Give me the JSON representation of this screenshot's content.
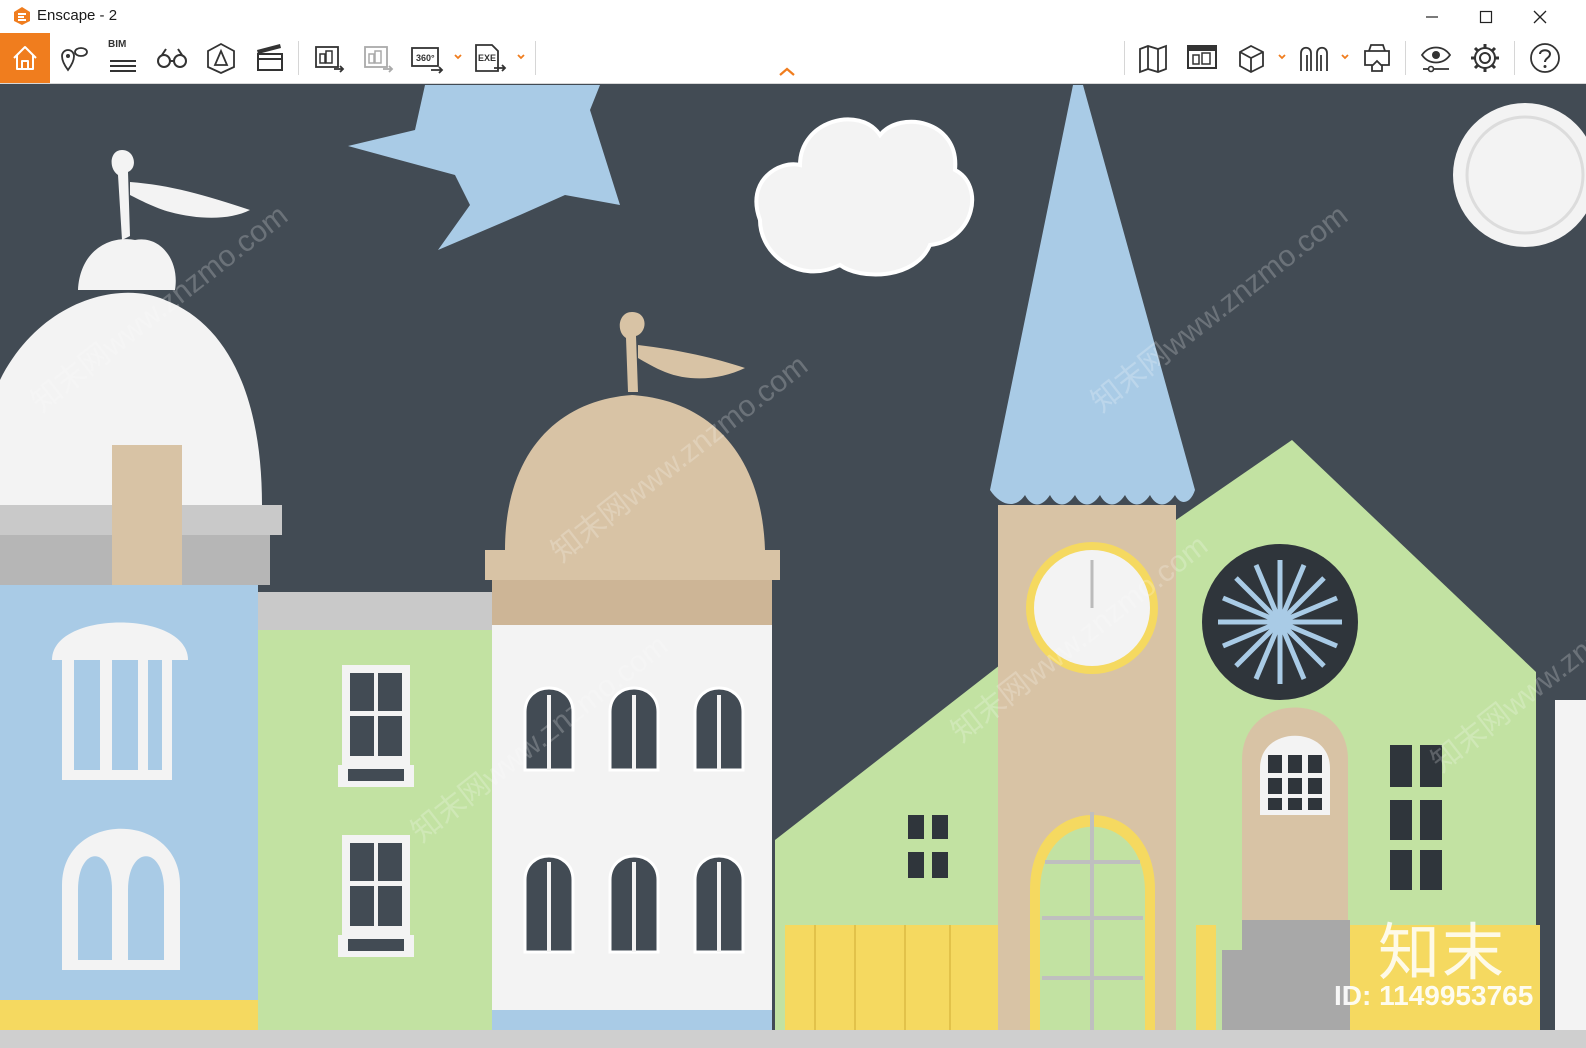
{
  "window": {
    "title": "Enscape - 2",
    "controls": {
      "minimize": "minimize",
      "maximize": "maximize",
      "close": "close"
    }
  },
  "toolbar": {
    "accent_color": "#f07d1e",
    "bim_label": "BIM",
    "pano_label": "360°",
    "exe_label": "EXE",
    "left_tools": [
      {
        "icon": "home-icon"
      },
      {
        "icon": "location-pin-icon"
      },
      {
        "icon": "bim-info-icon"
      },
      {
        "icon": "binoculars-icon"
      },
      {
        "icon": "perspective-icon"
      },
      {
        "icon": "clapperboard-icon"
      },
      {
        "icon": "batch-render-icon"
      },
      {
        "icon": "render-export-icon"
      },
      {
        "icon": "panorama-360-icon"
      },
      {
        "icon": "exe-export-icon"
      }
    ],
    "right_tools": [
      {
        "icon": "map-icon"
      },
      {
        "icon": "asset-library-icon"
      },
      {
        "icon": "section-box-icon"
      },
      {
        "icon": "collaboration-icon"
      },
      {
        "icon": "vr-headset-icon"
      },
      {
        "icon": "visual-settings-icon"
      },
      {
        "icon": "gear-icon"
      },
      {
        "icon": "help-icon"
      }
    ]
  },
  "viewport": {
    "scene": "paper-cut town wall relief",
    "watermarks": [
      "知末网www.znzmo.com"
    ],
    "logo_text": "知末",
    "id_text": "ID: 1149953765",
    "colors": {
      "wall": "#424b54",
      "blue": "#a9cbe6",
      "green": "#c2e2a2",
      "tan": "#d8c3a5",
      "white": "#f3f3f3",
      "yellow": "#f5d960"
    }
  }
}
